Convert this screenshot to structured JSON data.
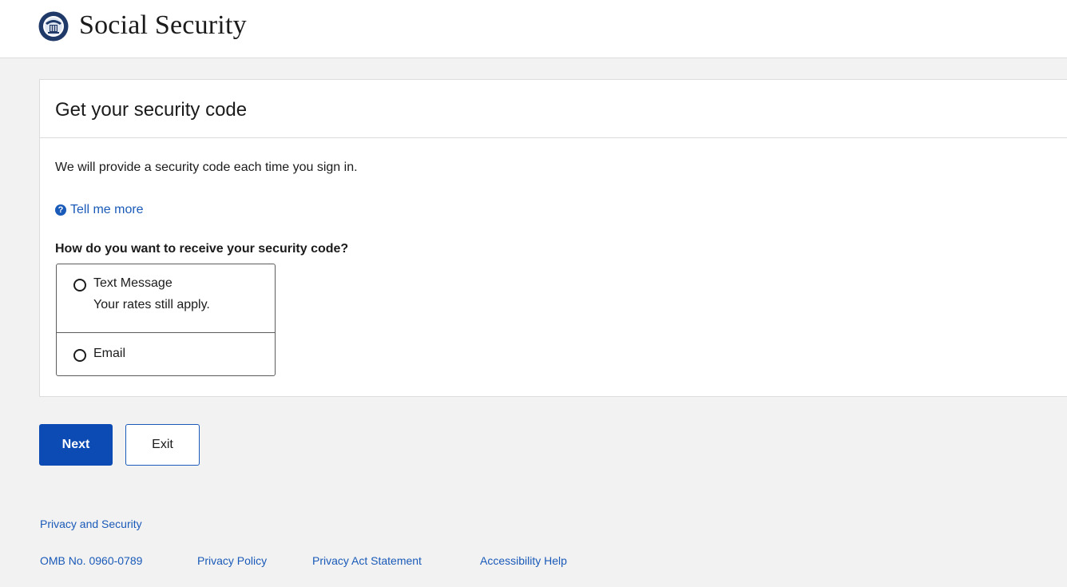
{
  "header": {
    "brand": "Social Security",
    "logo_icon": "ssa-seal-icon"
  },
  "panel": {
    "title": "Get your security code",
    "intro": "We will provide a security code each time you sign in.",
    "tell_more": "Tell me more",
    "tell_more_icon": "question-circle-icon",
    "question": "How do you want to receive your security code?",
    "options": [
      {
        "label": "Text Message",
        "sublabel": "Your rates still apply.",
        "selected": false
      },
      {
        "label": "Email",
        "selected": false
      }
    ]
  },
  "buttons": {
    "next": "Next",
    "exit": "Exit"
  },
  "footer": {
    "privacy_security": "Privacy and Security",
    "omb": "OMB No. 0960-0789",
    "links": [
      "Privacy Policy",
      "Privacy Act Statement",
      "Accessibility Help"
    ]
  },
  "colors": {
    "primary": "#0b4bb3",
    "link": "#1a5ab8",
    "background": "#f2f2f2"
  }
}
